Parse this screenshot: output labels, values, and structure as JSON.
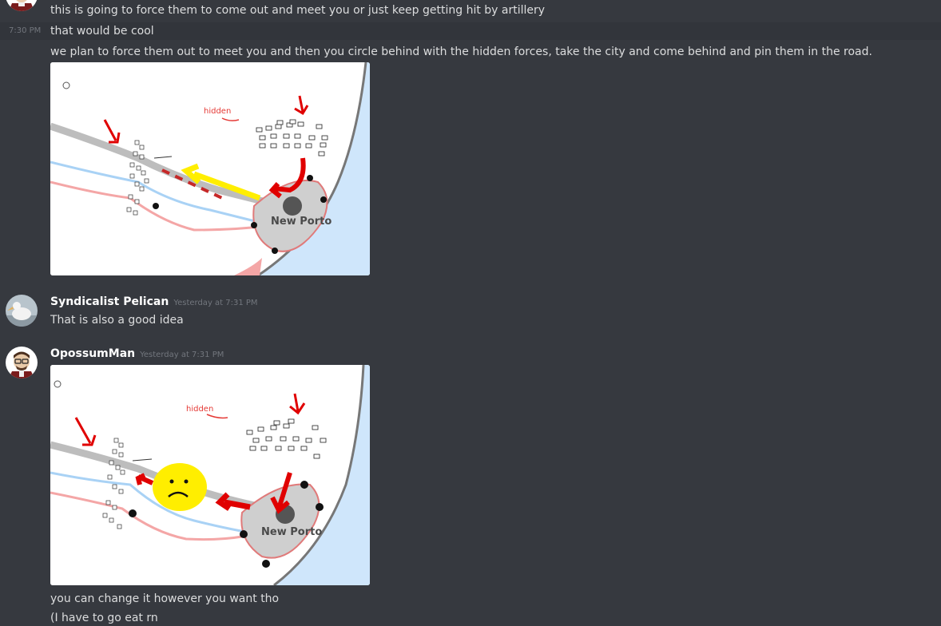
{
  "messages": {
    "m1": {
      "text": "this is going to force them to come out and meet you or just keep getting hit by artillery"
    },
    "m2": {
      "time": "7:30 PM",
      "text": "that would be cool"
    },
    "m3": {
      "text": "we plan to force them out to meet you and then you circle behind with the hidden forces, take the city and come behind and pin them in the road."
    },
    "image1": {
      "city_label": "New Porto",
      "hidden_label": "hidden"
    },
    "pelican": {
      "username": "Syndicalist Pelican",
      "timestamp": "Yesterday at 7:31 PM",
      "text": "That is also a good idea"
    },
    "opossum": {
      "username": "OpossumMan",
      "timestamp": "Yesterday at 7:31 PM"
    },
    "image2": {
      "city_label": "New Porto",
      "hidden_label": "hidden"
    },
    "m4": {
      "text": "you can change it however you want tho"
    },
    "m5": {
      "text": "(I have to go eat rn"
    }
  },
  "colors": {
    "background": "#36393f",
    "hover_row": "#32353b",
    "text": "#dcddde",
    "username": "#ffffff",
    "timestamp": "#72767d",
    "arrow_red": "#e00000",
    "arrow_yellow": "#ffee00",
    "sea": "#cfe6fb"
  }
}
